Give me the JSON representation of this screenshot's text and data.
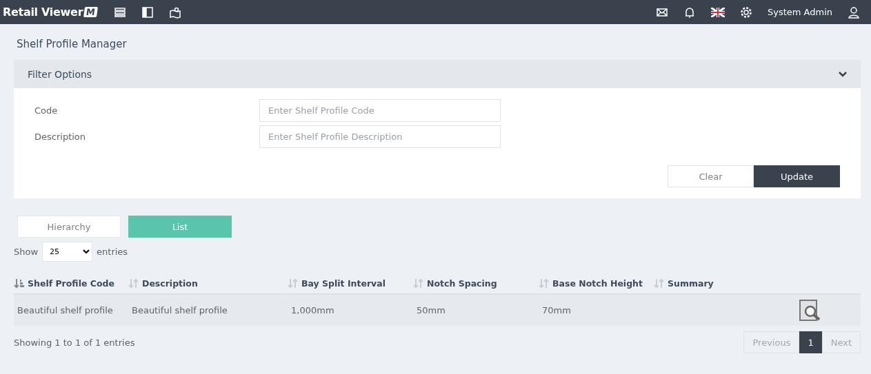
{
  "topbar": {
    "logo_text": "Retail Viewer",
    "logo_mark": "M",
    "user": "System Admin"
  },
  "page_title": "Shelf Profile Manager",
  "filter": {
    "title": "Filter Options",
    "expanded": true,
    "fields": [
      {
        "label": "Code",
        "placeholder": "Enter Shelf Profile Code"
      },
      {
        "label": "Description",
        "placeholder": "Enter Shelf Profile Description"
      }
    ],
    "buttons": [
      {
        "label": "Clear",
        "kind": "secondary"
      },
      {
        "label": "Update",
        "kind": "primary"
      }
    ]
  },
  "view_tabs": [
    {
      "label": "Hierarchy",
      "selected": false
    },
    {
      "label": "List",
      "selected": true
    }
  ],
  "length": {
    "prefix": "Show",
    "value": "25",
    "suffix": "entries"
  },
  "table": {
    "columns": [
      {
        "label": "Shelf Profile Code",
        "sorted": true
      },
      {
        "label": "Description",
        "sorted": false
      },
      {
        "label": "Bay Split Interval",
        "sorted": false
      },
      {
        "label": "Notch Spacing",
        "sorted": false
      },
      {
        "label": "Base Notch Height",
        "sorted": false
      },
      {
        "label": "Summary",
        "sorted": false
      }
    ],
    "rows": [
      {
        "cells": [
          "Beautiful shelf profile",
          "Beautiful shelf profile",
          "1,000mm",
          "50mm",
          "70mm",
          ""
        ]
      }
    ]
  },
  "info": "Showing 1 to 1 of 1 entries",
  "pagination": [
    {
      "label": "Previous",
      "kind": "nav",
      "selected": false
    },
    {
      "label": "1",
      "kind": "page",
      "selected": true
    },
    {
      "label": "Next",
      "kind": "nav",
      "selected": false
    }
  ]
}
